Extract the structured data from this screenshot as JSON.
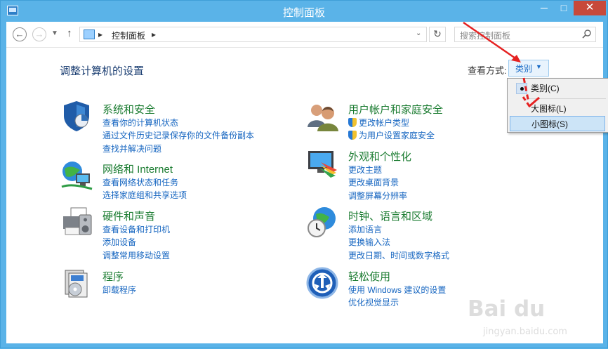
{
  "window": {
    "title": "控制面板",
    "controls": {
      "minimize": "─",
      "maximize": "□",
      "close": "✕"
    }
  },
  "toolbar": {
    "back_icon": "back-arrow",
    "forward_icon": "forward-arrow",
    "recent_icon": "chevron-down",
    "up_icon": "up-arrow",
    "breadcrumb": "控制面板",
    "breadcrumb_separator": "▸",
    "dropdown_icon": "chevron-down",
    "refresh_icon": "refresh",
    "search_placeholder": "搜索控制面板",
    "search_icon": "magnifier"
  },
  "main": {
    "title": "调整计算机的设置",
    "view_by_label": "查看方式:",
    "view_by_value": "类别",
    "view_menu": [
      {
        "label": "类别(C)",
        "checked": true
      },
      {
        "label": "大图标(L)",
        "checked": false
      },
      {
        "label": "小图标(S)",
        "checked": false,
        "highlighted": true
      }
    ]
  },
  "categories": [
    {
      "title": "系统和安全",
      "icon": "shield-icon",
      "links": [
        "查看你的计算机状态",
        "通过文件历史记录保存你的文件备份副本",
        "查找并解决问题"
      ]
    },
    {
      "title": "网络和 Internet",
      "icon": "network-icon",
      "links": [
        "查看网络状态和任务",
        "选择家庭组和共享选项"
      ]
    },
    {
      "title": "硬件和声音",
      "icon": "printer-icon",
      "links": [
        "查看设备和打印机",
        "添加设备",
        "调整常用移动设置"
      ]
    },
    {
      "title": "程序",
      "icon": "programs-icon",
      "links": [
        "卸载程序"
      ]
    },
    {
      "title": "用户帐户和家庭安全",
      "icon": "users-icon",
      "links": [
        "更改帐户类型",
        "为用户设置家庭安全"
      ]
    },
    {
      "title": "外观和个性化",
      "icon": "appearance-icon",
      "links": [
        "更改主题",
        "更改桌面背景",
        "调整屏幕分辨率"
      ]
    },
    {
      "title": "时钟、语言和区域",
      "icon": "clock-globe-icon",
      "links": [
        "添加语言",
        "更换输入法",
        "更改日期、时间或数字格式"
      ]
    },
    {
      "title": "轻松使用",
      "icon": "ease-of-access-icon",
      "links": [
        "使用 Windows 建议的设置",
        "优化视觉显示"
      ]
    }
  ],
  "colors": {
    "title_bar": "#5ab3e8",
    "category_title": "#1b7c31",
    "link": "#1565c0",
    "page_title": "#1b3e72",
    "annotation_arrow": "#e52121"
  },
  "watermark": {
    "logo": "Bai du",
    "sub": "jingyan.baidu.com"
  }
}
